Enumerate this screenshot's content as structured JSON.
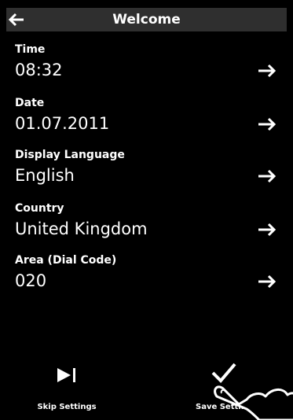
{
  "header": {
    "title": "Welcome",
    "back_icon": "arrow-left-icon"
  },
  "settings": [
    {
      "label": "Time",
      "value": "08:32",
      "icon": "arrow-right-icon"
    },
    {
      "label": "Date",
      "value": "01.07.2011",
      "icon": "arrow-right-icon"
    },
    {
      "label": "Display Language",
      "value": "English",
      "icon": "arrow-right-icon"
    },
    {
      "label": "Country",
      "value": "United Kingdom",
      "icon": "arrow-right-icon"
    },
    {
      "label": "Area (Dial Code)",
      "value": "020",
      "icon": "arrow-right-icon"
    }
  ],
  "footer": {
    "skip_label": "Skip Settings",
    "skip_icon": "skip-icon",
    "save_label": "Save Setting",
    "save_icon": "checkmark-icon"
  },
  "overlay": {
    "hand_icon": "finger-icon"
  },
  "colors": {
    "background": "#000000",
    "header": "#2f2f2f",
    "text": "#ffffff"
  }
}
